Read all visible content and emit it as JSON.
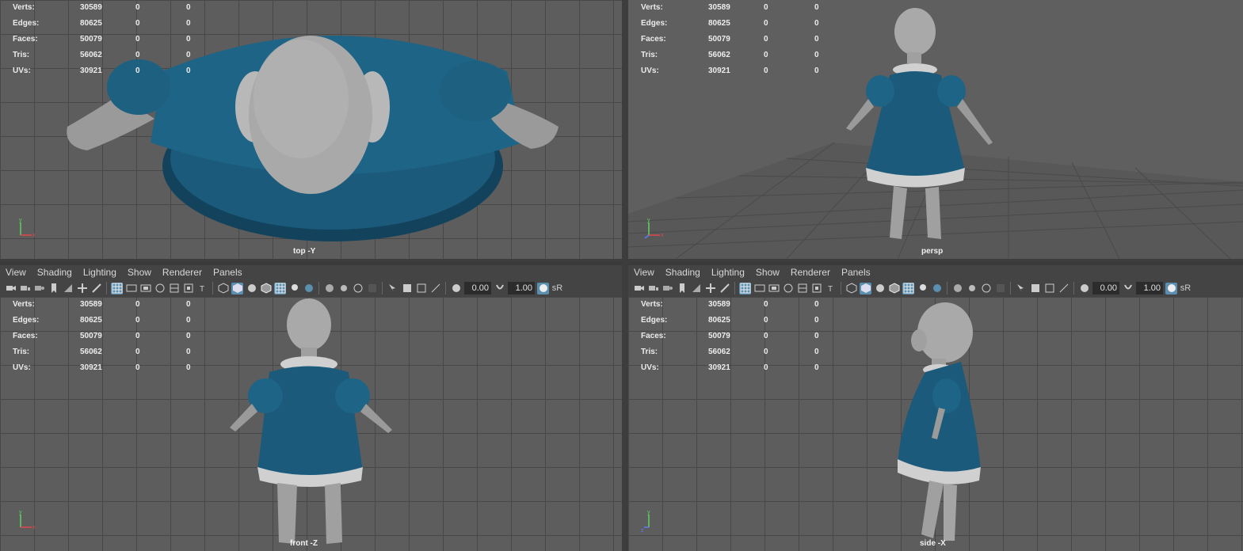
{
  "stats": {
    "rows": [
      {
        "label": "Verts:",
        "v1": "30589",
        "v2": "0",
        "v3": "0"
      },
      {
        "label": "Edges:",
        "v1": "80625",
        "v2": "0",
        "v3": "0"
      },
      {
        "label": "Faces:",
        "v1": "50079",
        "v2": "0",
        "v3": "0"
      },
      {
        "label": "Tris:",
        "v1": "56062",
        "v2": "0",
        "v3": "0"
      },
      {
        "label": "UVs:",
        "v1": "30921",
        "v2": "0",
        "v3": "0"
      }
    ]
  },
  "viewports": {
    "top_left": {
      "camera": "top -Y"
    },
    "top_right": {
      "camera": "persp"
    },
    "bottom_left": {
      "camera": "front -Z"
    },
    "bottom_right": {
      "camera": "side -X"
    }
  },
  "panel_menu": [
    "View",
    "Shading",
    "Lighting",
    "Show",
    "Renderer",
    "Panels"
  ],
  "toolbar": {
    "exposure": "0.00",
    "gamma": "1.00",
    "color_space": "sR"
  },
  "axis": {
    "y": "y",
    "x": "x",
    "z": "z"
  },
  "colors": {
    "viewport_bg": "#5d5d5d",
    "grid": "#484848",
    "dress": "#1b5a7a",
    "skin": "#a6a6a6",
    "accent": "#5a8fb0"
  }
}
